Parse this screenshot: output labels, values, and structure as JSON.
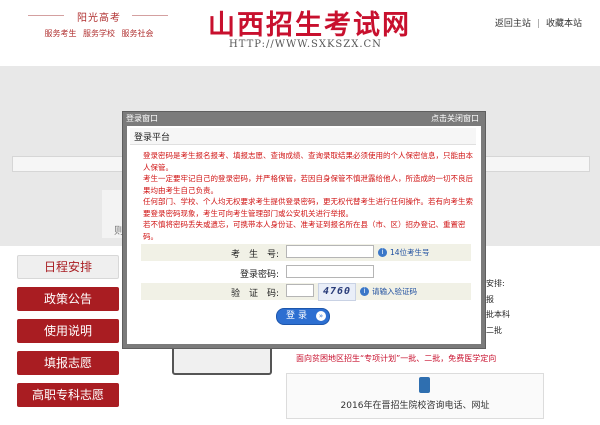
{
  "header": {
    "slogan_title": "阳光高考",
    "slogan_sub": "服务考生 服务学校 服务社会",
    "site_title": "山西招生考试网",
    "site_url": "HTTP://WWW.SXKSZX.CN",
    "link_home": "返回主站",
    "link_fav": "收藏本站",
    "link_sep": "|"
  },
  "band": {
    "partial_text": "则"
  },
  "menu": {
    "items": [
      {
        "label": "日程安排",
        "active": true
      },
      {
        "label": "政策公告",
        "active": false
      },
      {
        "label": "使用说明",
        "active": false
      },
      {
        "label": "填报志愿",
        "active": false
      },
      {
        "label": "高职专科志愿",
        "active": false
      }
    ]
  },
  "news": {
    "lines": [
      "间安排:",
      "填报",
      "",
      "二批本科",
      "",
      "",
      "前二批"
    ],
    "red_line": "面向贫困地区招生“专项计划”一批、二批，免费医学定向",
    "consult": "2016年在晋招生院校咨询电话、网址"
  },
  "dialog": {
    "titlebar": "登录窗口",
    "close": "点击关闭窗口",
    "heading": "登录平台",
    "notice": [
      "登录密码是考生报名报考、填报志愿、查询成绩、查询录取结果必须使用的个人保密信息，只能由本人保管。",
      "考生一定要牢记自己的登录密码，并严格保管，若因自身保管不慎泄露给他人，所造成的一切不良后果均由考生自己负责。",
      "任何部门、学校、个人均无权要求考生提供登录密码，更无权代替考生进行任何操作。若有向考生索要登录密码现象，考生可向考生管理部门或公安机关进行举报。",
      "若不慎将密码丢失或遗忘，可携带本人身份证、准考证到报名所在县（市、区）招办登记、重置密码。"
    ],
    "fields": {
      "exam_no_label": "考　生　号:",
      "exam_no_value": "",
      "exam_no_hint": "14位考生号",
      "password_label": "登录密码:",
      "password_value": "",
      "captcha_label": "验　证　码:",
      "captcha_value": "",
      "captcha_image": "4760",
      "captcha_hint": "请输入验证码"
    },
    "login_label": "登录",
    "login_arrow": "»"
  }
}
